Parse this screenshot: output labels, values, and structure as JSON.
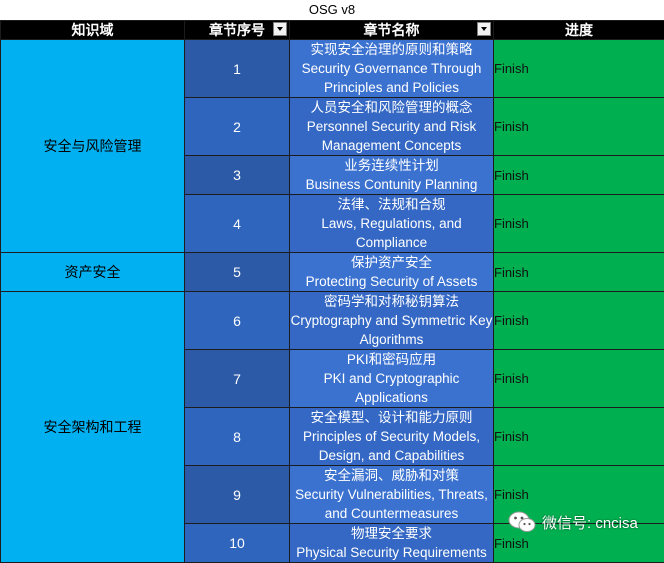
{
  "title": "OSG v8",
  "headers": {
    "domain": "知识域",
    "chapter_no": "章节序号",
    "chapter_name": "章节名称",
    "progress": "进度"
  },
  "domains": [
    {
      "name": "安全与风险管理"
    },
    {
      "name": "资产安全"
    },
    {
      "name": "安全架构和工程"
    }
  ],
  "rows": [
    {
      "no": "1",
      "cn": "实现安全治理的原则和策略",
      "en": "Security Governance Through Principles and Policies",
      "status": "Finish"
    },
    {
      "no": "2",
      "cn": "人员安全和风险管理的概念",
      "en": "Personnel Security and Risk Management Concepts",
      "status": "Finish"
    },
    {
      "no": "3",
      "cn": "业务连续性计划",
      "en": "Business Contunity Planning",
      "status": "Finish"
    },
    {
      "no": "4",
      "cn": "法律、法规和合规",
      "en": "Laws, Regulations, and Compliance",
      "status": "Finish"
    },
    {
      "no": "5",
      "cn": "保护资产安全",
      "en": "Protecting Security of Assets",
      "status": "Finish"
    },
    {
      "no": "6",
      "cn": "密码学和对称秘钥算法",
      "en": "Cryptography and Symmetric Key Algorithms",
      "status": "Finish"
    },
    {
      "no": "7",
      "cn": "PKI和密码应用",
      "en": "PKI and Cryptographic Applications",
      "status": "Finish"
    },
    {
      "no": "8",
      "cn": "安全模型、设计和能力原则",
      "en": "Principles of Security Models, Design, and Capabilities",
      "status": "Finish"
    },
    {
      "no": "9",
      "cn": "安全漏洞、威胁和对策",
      "en": "Security Vulnerabilities, Threats, and Countermeasures",
      "status": "Finish"
    },
    {
      "no": "10",
      "cn": "物理安全要求",
      "en": "Physical Security Requirements",
      "status": "Finish"
    }
  ],
  "watermark": "微信号: cncisa",
  "colors": {
    "header_bg": "#000000",
    "domain_bg": "#00b0f0",
    "chapter_bg": "#3468c4",
    "progress_bg": "#00b050"
  }
}
